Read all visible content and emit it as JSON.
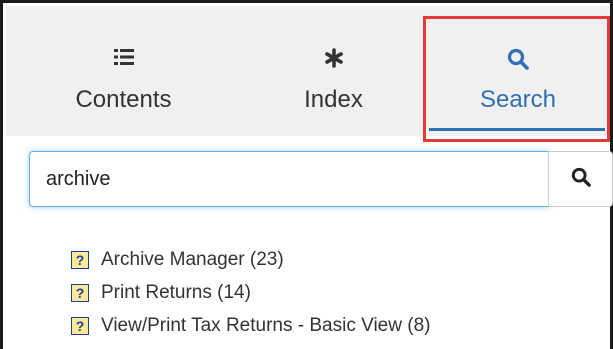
{
  "tabs": [
    {
      "label": "Contents",
      "icon": "list-icon"
    },
    {
      "label": "Index",
      "icon": "asterisk-icon"
    },
    {
      "label": "Search",
      "icon": "search-icon"
    }
  ],
  "active_tab": "Search",
  "search": {
    "value": "archive",
    "button_icon": "search-icon"
  },
  "results": [
    {
      "label": "Archive Manager (23)",
      "icon": "help-topic-icon"
    },
    {
      "label": "Print Returns (14)",
      "icon": "help-topic-icon"
    },
    {
      "label": "View/Print Tax Returns - Basic View (8)",
      "icon": "help-topic-icon"
    }
  ],
  "help_icon_glyph": "?",
  "colors": {
    "accent": "#2f6fb2",
    "highlight_box": "#e53935",
    "tab_bar_bg": "#f0f0f0",
    "input_focus": "#66afe9"
  }
}
